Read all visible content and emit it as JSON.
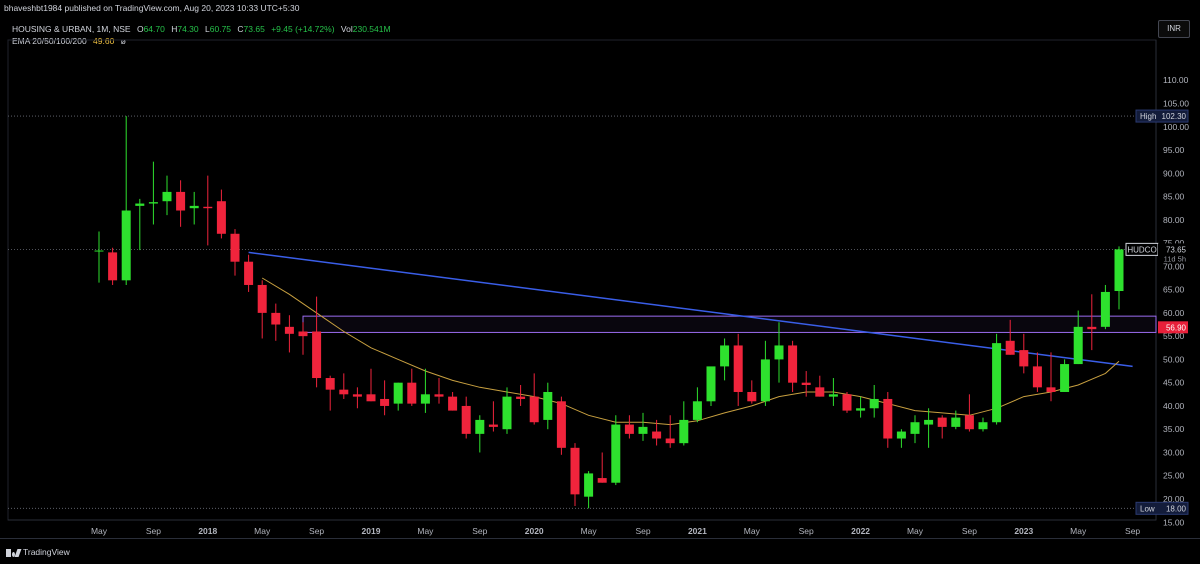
{
  "header": {
    "published_line": "bhaveshbt1984 published on TradingView.com, Aug 20, 2023 10:33 UTC+5:30",
    "symbol_line": "HOUSING & URBAN, 1M, NSE",
    "ohlc": {
      "o_label": "O",
      "o": "64.70",
      "h_label": "H",
      "h": "74.30",
      "l_label": "L",
      "l": "60.75",
      "c_label": "C",
      "c": "73.65",
      "change": "+9.45 (+14.72%)",
      "vol_label": "Vol",
      "vol": "230.541M"
    },
    "ema_label": "EMA 20/50/100/200",
    "ema_value": "49.60",
    "ema_extra": "ø"
  },
  "currency": "INR",
  "footer": {
    "brand": "TradingView"
  },
  "colors": {
    "up": "#2ee12e",
    "down": "#f0243c",
    "ema": "#c8a040",
    "trendline": "#3a5ee8",
    "zone": "#9b6cf0",
    "bg": "#000000"
  },
  "chart_data": {
    "type": "candlestick",
    "symbol": "HUDCO",
    "interval": "1M",
    "ylim": [
      12.5,
      117.5
    ],
    "y_ticks": [
      "15.00",
      "20.00",
      "25.00",
      "30.00",
      "35.00",
      "40.00",
      "45.00",
      "50.00",
      "55.00",
      "60.00",
      "65.00",
      "70.00",
      "75.00",
      "80.00",
      "85.00",
      "90.00",
      "95.00",
      "100.00",
      "105.00",
      "110.00"
    ],
    "x_ticks": [
      "May",
      "Sep",
      "2018",
      "May",
      "Sep",
      "2019",
      "May",
      "Sep",
      "2020",
      "May",
      "Sep",
      "2021",
      "May",
      "Sep",
      "2022",
      "May",
      "Sep",
      "2023",
      "May",
      "Sep"
    ],
    "x_tick_months": [
      0,
      4,
      8,
      12,
      16,
      20,
      24,
      28,
      32,
      36,
      40,
      44,
      48,
      52,
      56,
      60,
      64,
      68,
      72,
      76
    ],
    "candles": [
      [
        0,
        73.2,
        77.5,
        66.5,
        73.4
      ],
      [
        1,
        73.0,
        74.0,
        66.0,
        67.0
      ],
      [
        2,
        67.0,
        102.3,
        66.0,
        82.0
      ],
      [
        3,
        83.0,
        84.5,
        73.5,
        83.5
      ],
      [
        4,
        83.5,
        92.5,
        79.0,
        83.8
      ],
      [
        5,
        84.0,
        89.5,
        81.0,
        86.0
      ],
      [
        6,
        86.0,
        88.5,
        78.5,
        82.0
      ],
      [
        7,
        82.5,
        86.0,
        79.0,
        83.0
      ],
      [
        8,
        82.8,
        89.5,
        74.5,
        82.5
      ],
      [
        9,
        84.0,
        86.5,
        76.0,
        77.0
      ],
      [
        10,
        77.0,
        78.0,
        68.0,
        71.0
      ],
      [
        11,
        71.0,
        72.5,
        64.5,
        66.0
      ],
      [
        12,
        66.0,
        67.0,
        54.5,
        60.0
      ],
      [
        13,
        60.0,
        62.0,
        54.0,
        57.5
      ],
      [
        14,
        57.0,
        59.5,
        51.5,
        55.5
      ],
      [
        15,
        56.0,
        58.0,
        51.0,
        55.0
      ],
      [
        16,
        56.0,
        63.5,
        44.0,
        46.0
      ],
      [
        17,
        46.0,
        46.5,
        39.0,
        43.5
      ],
      [
        18,
        43.5,
        47.0,
        41.5,
        42.5
      ],
      [
        19,
        42.5,
        44.0,
        39.5,
        42.0
      ],
      [
        20,
        42.5,
        48.0,
        41.0,
        41.0
      ],
      [
        21,
        41.5,
        45.5,
        38.0,
        40.0
      ],
      [
        22,
        40.5,
        45.0,
        39.0,
        45.0
      ],
      [
        23,
        45.0,
        48.0,
        40.0,
        40.5
      ],
      [
        24,
        40.5,
        48.0,
        38.5,
        42.5
      ],
      [
        25,
        42.5,
        46.0,
        40.5,
        42.0
      ],
      [
        26,
        42.0,
        43.0,
        39.0,
        39.0
      ],
      [
        27,
        40.0,
        42.0,
        33.0,
        34.0
      ],
      [
        28,
        34.0,
        38.0,
        30.0,
        37.0
      ],
      [
        29,
        36.0,
        41.0,
        34.5,
        35.5
      ],
      [
        30,
        35.0,
        44.0,
        34.0,
        42.0
      ],
      [
        31,
        42.0,
        44.5,
        40.0,
        41.5
      ],
      [
        32,
        42.0,
        47.0,
        36.0,
        36.5
      ],
      [
        33,
        37.0,
        45.0,
        35.0,
        43.0
      ],
      [
        34,
        41.0,
        42.0,
        29.5,
        31.0
      ],
      [
        35,
        31.0,
        32.0,
        18.5,
        21.0
      ],
      [
        36,
        20.5,
        26.0,
        18.0,
        25.5
      ],
      [
        37,
        24.5,
        30.0,
        23.5,
        23.5
      ],
      [
        38,
        23.5,
        38.0,
        23.0,
        36.0
      ],
      [
        39,
        36.0,
        38.0,
        33.0,
        34.0
      ],
      [
        40,
        34.0,
        38.5,
        32.5,
        35.5
      ],
      [
        41,
        34.5,
        37.0,
        31.5,
        33.0
      ],
      [
        42,
        33.0,
        38.0,
        31.0,
        32.0
      ],
      [
        43,
        32.0,
        41.0,
        31.5,
        37.0
      ],
      [
        44,
        37.0,
        44.0,
        36.5,
        41.0
      ],
      [
        45,
        41.0,
        48.0,
        40.0,
        48.5
      ],
      [
        46,
        48.5,
        54.5,
        45.5,
        53.0
      ],
      [
        47,
        53.0,
        55.5,
        40.0,
        43.0
      ],
      [
        48,
        43.0,
        45.5,
        40.5,
        41.0
      ],
      [
        49,
        41.0,
        54.0,
        40.0,
        50.0
      ],
      [
        50,
        50.0,
        58.0,
        45.0,
        53.0
      ],
      [
        51,
        53.0,
        54.0,
        43.0,
        45.0
      ],
      [
        52,
        45.0,
        47.5,
        42.0,
        44.5
      ],
      [
        53,
        44.0,
        46.5,
        42.0,
        42.0
      ],
      [
        54,
        42.0,
        46.0,
        40.0,
        42.5
      ],
      [
        55,
        42.5,
        43.0,
        38.5,
        39.0
      ],
      [
        56,
        39.0,
        42.0,
        37.5,
        39.5
      ],
      [
        57,
        39.5,
        44.5,
        37.5,
        41.5
      ],
      [
        58,
        41.5,
        43.0,
        31.0,
        33.0
      ],
      [
        59,
        33.0,
        35.0,
        31.0,
        34.5
      ],
      [
        60,
        34.0,
        38.0,
        32.0,
        36.5
      ],
      [
        61,
        36.0,
        39.5,
        31.0,
        37.0
      ],
      [
        62,
        37.5,
        38.0,
        33.0,
        35.5
      ],
      [
        63,
        35.5,
        39.0,
        35.0,
        37.5
      ],
      [
        64,
        38.0,
        42.5,
        34.5,
        35.0
      ],
      [
        65,
        35.0,
        37.5,
        34.5,
        36.5
      ],
      [
        66,
        36.5,
        55.5,
        36.0,
        53.5
      ],
      [
        67,
        54.0,
        58.5,
        51.0,
        51.0
      ],
      [
        68,
        52.0,
        55.5,
        47.0,
        48.5
      ],
      [
        69,
        48.5,
        51.5,
        43.0,
        44.0
      ],
      [
        70,
        44.0,
        51.5,
        41.0,
        43.0
      ],
      [
        71,
        43.0,
        50.0,
        43.0,
        49.0
      ],
      [
        72,
        49.0,
        60.5,
        49.0,
        57.0
      ],
      [
        73,
        57.0,
        64.0,
        52.0,
        56.5
      ],
      [
        74,
        57.0,
        66.0,
        56.5,
        64.5
      ],
      [
        75,
        64.7,
        74.3,
        60.75,
        73.65
      ]
    ],
    "ema_20": [
      [
        12,
        67.5
      ],
      [
        14,
        64.0
      ],
      [
        16,
        60.0
      ],
      [
        18,
        56.0
      ],
      [
        20,
        52.5
      ],
      [
        22,
        50.0
      ],
      [
        24,
        47.5
      ],
      [
        26,
        45.5
      ],
      [
        28,
        44.0
      ],
      [
        30,
        43.0
      ],
      [
        32,
        42.0
      ],
      [
        34,
        40.5
      ],
      [
        36,
        38.0
      ],
      [
        38,
        36.5
      ],
      [
        40,
        36.5
      ],
      [
        42,
        36.0
      ],
      [
        44,
        36.8
      ],
      [
        46,
        38.5
      ],
      [
        48,
        40.0
      ],
      [
        50,
        42.0
      ],
      [
        52,
        43.0
      ],
      [
        54,
        43.0
      ],
      [
        56,
        42.0
      ],
      [
        58,
        40.5
      ],
      [
        60,
        39.0
      ],
      [
        62,
        38.5
      ],
      [
        64,
        38.0
      ],
      [
        66,
        39.5
      ],
      [
        68,
        42.0
      ],
      [
        70,
        43.0
      ],
      [
        72,
        44.5
      ],
      [
        74,
        47.0
      ],
      [
        75,
        49.6
      ]
    ],
    "trendline": {
      "from": [
        11,
        73.0
      ],
      "to": [
        76,
        48.5
      ]
    },
    "resistance_zone": [
      55.8,
      59.3
    ],
    "zone_start_month": 15,
    "h_levels": [
      102.3,
      73.65,
      18.0
    ],
    "price_labels": [
      {
        "text": "High",
        "value": "102.30",
        "y": 102.3,
        "kind": "high"
      },
      {
        "text": "HUDCO",
        "value": "73.65",
        "sub": "11d 5h",
        "y": 73.65,
        "kind": "symbol"
      },
      {
        "text": "",
        "value": "56.90",
        "y": 56.9,
        "kind": "red"
      },
      {
        "text": "Low",
        "value": "18.00",
        "y": 18.0,
        "kind": "low"
      }
    ]
  }
}
